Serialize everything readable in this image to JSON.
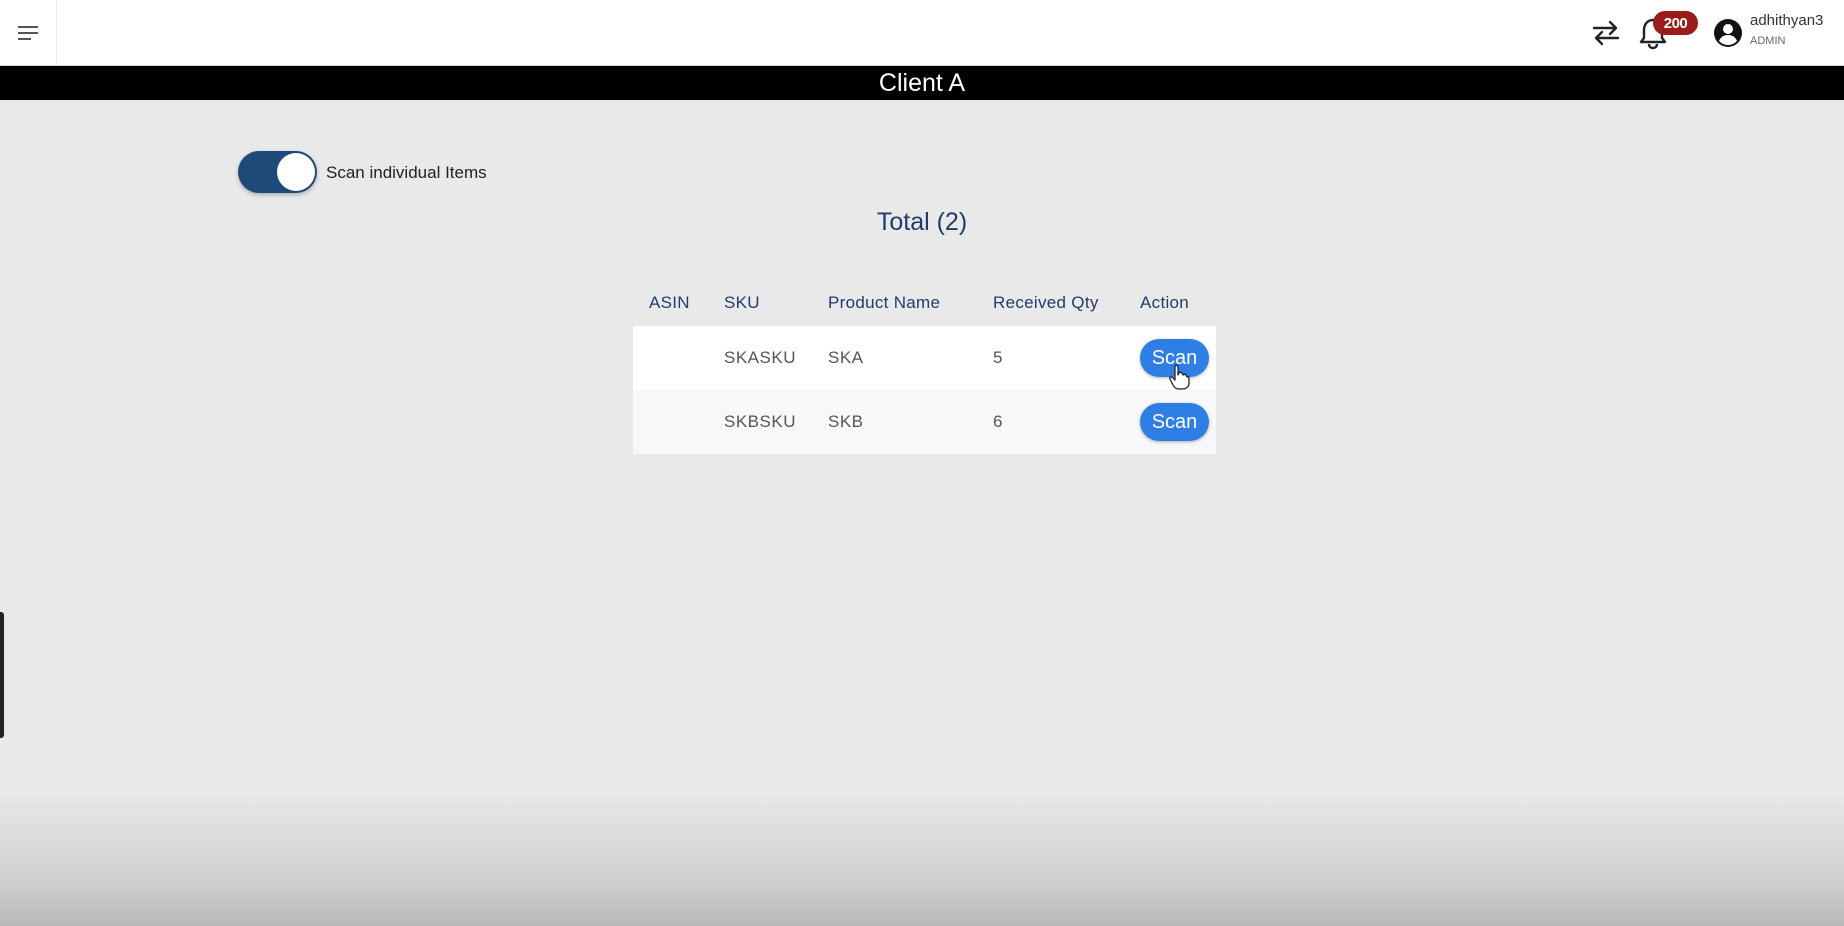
{
  "topbar": {
    "menu_icon": "hamburger-menu-icon",
    "swap_icon": "swap-arrows-icon",
    "bell_icon": "bell-icon",
    "notification_count": "200",
    "avatar_icon": "account-circle-icon",
    "user_name": "adhithyan3",
    "user_role": "ADMIN"
  },
  "page": {
    "title": "Client A",
    "toggle_label": "Scan individual Items",
    "toggle_on": true,
    "total_label": "Total (2)"
  },
  "table": {
    "headers": {
      "asin": "ASIN",
      "sku": "SKU",
      "product_name": "Product Name",
      "received_qty": "Received Qty",
      "action": "Action"
    },
    "rows": [
      {
        "asin": "",
        "sku": "SKASKU",
        "product_name": "SKA",
        "received_qty": "5",
        "action": "Scan"
      },
      {
        "asin": "",
        "sku": "SKBSKU",
        "product_name": "SKB",
        "received_qty": "6",
        "action": "Scan"
      }
    ]
  },
  "colors": {
    "title_bar": "#000000",
    "toggle": "#1e4a79",
    "scan_button": "#2f7ee6",
    "badge": "#9c1c1c",
    "heading_text": "#1f3d6b"
  }
}
